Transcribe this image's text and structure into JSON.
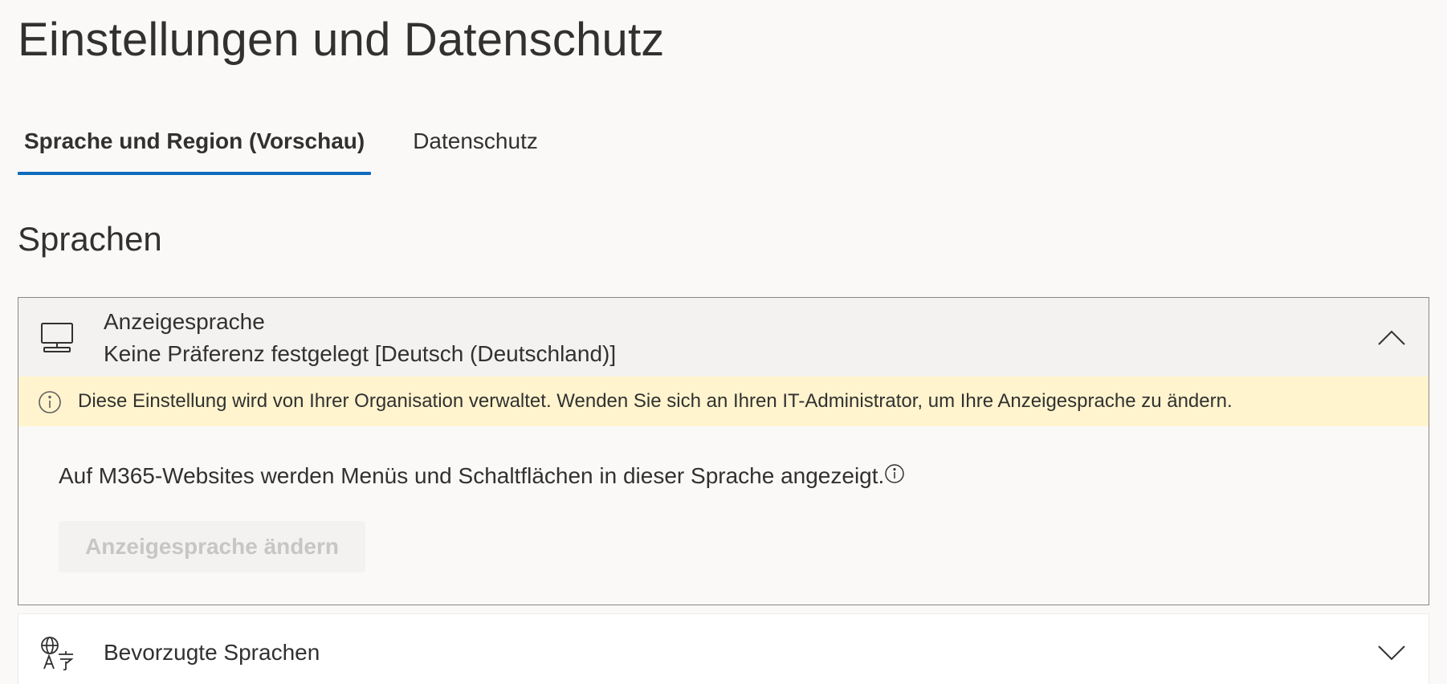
{
  "page": {
    "title": "Einstellungen und Datenschutz"
  },
  "tabs": [
    {
      "label": "Sprache und Region (Vorschau)",
      "active": true
    },
    {
      "label": "Datenschutz",
      "active": false
    }
  ],
  "languages_section": {
    "title": "Sprachen",
    "display_language": {
      "title": "Anzeigesprache",
      "value": "Keine Präferenz festgelegt [Deutsch (Deutschland)]",
      "expanded": true,
      "icon": "monitor-icon",
      "banner_text": "Diese Einstellung wird von Ihrer Organisation verwaltet. Wenden Sie sich an Ihren IT-Administrator, um Ihre Anzeigesprache zu ändern.",
      "description": "Auf M365-Websites werden Menüs und Schaltflächen in dieser Sprache angezeigt.",
      "change_button": "Anzeigesprache ändern",
      "change_button_disabled": true
    },
    "preferred_languages": {
      "title": "Bevorzugte Sprachen",
      "expanded": false,
      "icon": "language-translate-icon"
    }
  },
  "colors": {
    "accent": "#0f6cbd",
    "banner_background": "#fff4ce",
    "page_background": "#faf9f8"
  }
}
